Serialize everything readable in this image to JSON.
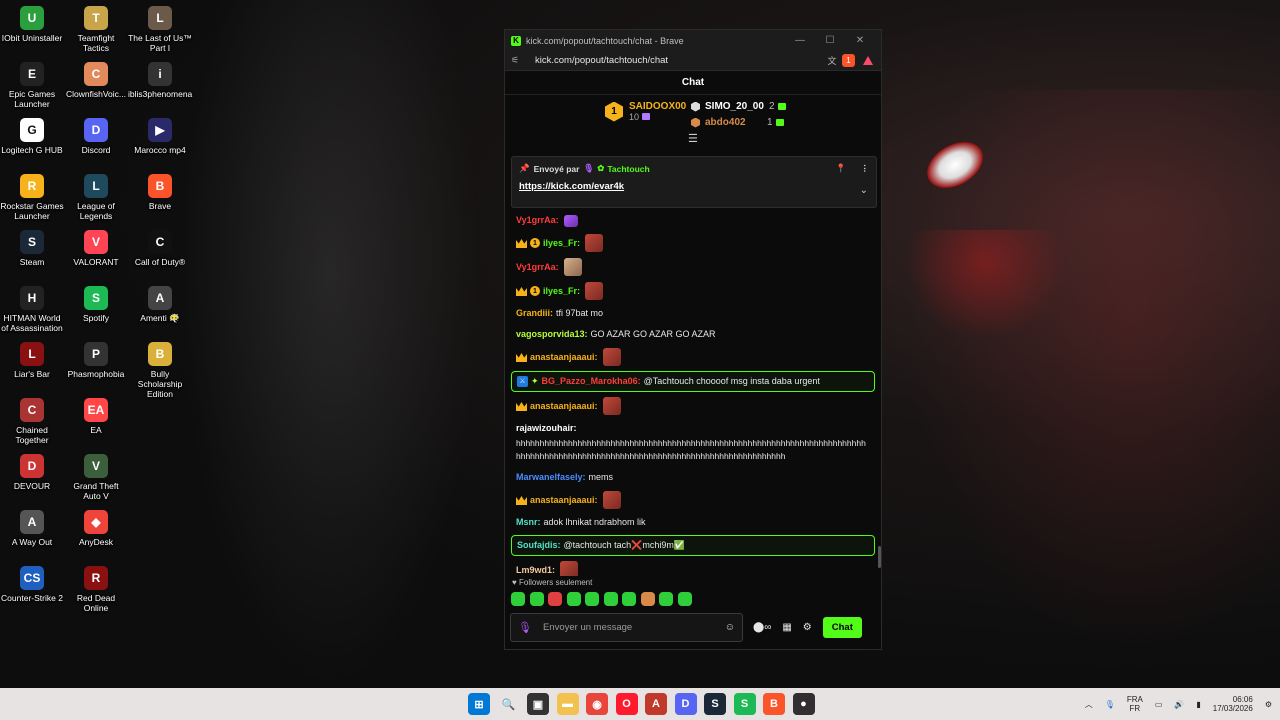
{
  "desktop": {
    "icons": [
      {
        "label": "IObit Uninstaller",
        "color": "#2b9e3d",
        "glyph": "U"
      },
      {
        "label": "Teamfight Tactics",
        "color": "#c8a54a",
        "glyph": "T"
      },
      {
        "label": "The Last of Us™ Part I",
        "color": "#6b5a4a",
        "glyph": "L"
      },
      {
        "label": "Epic Games Launcher",
        "color": "#222222",
        "glyph": "E"
      },
      {
        "label": "ClownfishVoic...",
        "color": "#e28a5c",
        "glyph": "C"
      },
      {
        "label": "iblis3phenomena",
        "color": "#333333",
        "glyph": "i"
      },
      {
        "label": "Logitech G HUB",
        "color": "#ffffff",
        "glyph": "G"
      },
      {
        "label": "Discord",
        "color": "#5865f2",
        "glyph": "D"
      },
      {
        "label": "Marocco mp4",
        "color": "#2a2a6a",
        "glyph": "▶"
      },
      {
        "label": "Rockstar Games Launcher",
        "color": "#f5b21b",
        "glyph": "R"
      },
      {
        "label": "League of Legends",
        "color": "#1f4a5e",
        "glyph": "L"
      },
      {
        "label": "Brave",
        "color": "#fb542b",
        "glyph": "B"
      },
      {
        "label": "Steam",
        "color": "#1b2838",
        "glyph": "S"
      },
      {
        "label": "VALORANT",
        "color": "#fd4556",
        "glyph": "V"
      },
      {
        "label": "Call of Duty®",
        "color": "#111111",
        "glyph": "C"
      },
      {
        "label": "HITMAN World of Assassination",
        "color": "#222222",
        "glyph": "H"
      },
      {
        "label": "Spotify",
        "color": "#1db954",
        "glyph": "S"
      },
      {
        "label": "Amenti 😶‍🌫️",
        "color": "#444444",
        "glyph": "A"
      },
      {
        "label": "Liar's Bar",
        "color": "#8a1111",
        "glyph": "L"
      },
      {
        "label": "Phasmophobia",
        "color": "#333333",
        "glyph": "P"
      },
      {
        "label": "Bully Scholarship Edition",
        "color": "#d9b13a",
        "glyph": "B"
      },
      {
        "label": "Chained Together",
        "color": "#a33",
        "glyph": "C"
      },
      {
        "label": "EA",
        "color": "#ff4747",
        "glyph": "EA"
      },
      {
        "label": "DEVOUR",
        "color": "#c33",
        "glyph": "D"
      },
      {
        "label": "Grand Theft Auto V",
        "color": "#3a5f3a",
        "glyph": "V"
      },
      {
        "label": "A Way Out",
        "color": "#555555",
        "glyph": "A"
      },
      {
        "label": "AnyDesk",
        "color": "#ef443b",
        "glyph": "◆"
      },
      {
        "label": "Counter-Strike 2",
        "color": "#1f5fbf",
        "glyph": "CS"
      },
      {
        "label": "Red Dead Online",
        "color": "#8a1111",
        "glyph": "R"
      }
    ]
  },
  "browser": {
    "title": "kick.com/popout/tachtouch/chat - Brave",
    "url": "kick.com/popout/tachtouch/chat",
    "brave_badge": "1",
    "min_label": "—",
    "max_label": "☐",
    "close_label": "✕"
  },
  "chat": {
    "header": "Chat",
    "leaderboard": {
      "first": {
        "rank": "1",
        "name": "SAIDOOX00",
        "count": "10"
      },
      "second": {
        "name": "SIMO_20_00",
        "count": "2"
      },
      "third": {
        "name": "abdo402",
        "count": "1"
      }
    },
    "pinned": {
      "prefix": "Envoyé par",
      "author": "Tachtouch",
      "link": "https://kick.com/evar4k"
    },
    "messages": [
      {
        "user": "Vy1grrAa",
        "color": "#ff3b3b",
        "text": "",
        "badges": [],
        "emote": "purple",
        "highlight": false
      },
      {
        "user": "ilyes_Fr",
        "color": "#53fc18",
        "text": "",
        "badges": [
          "crown",
          "coin"
        ],
        "emote": "red",
        "highlight": false
      },
      {
        "user": "Vy1grrAa",
        "color": "#ff3b3b",
        "text": "",
        "badges": [],
        "emote": "beige",
        "highlight": false
      },
      {
        "user": "ilyes_Fr",
        "color": "#53fc18",
        "text": "",
        "badges": [
          "crown",
          "coin"
        ],
        "emote": "red",
        "highlight": false
      },
      {
        "user": "Grandiii",
        "color": "#f5b21b",
        "text": "tfi 97bat mo",
        "badges": [],
        "emote": "",
        "highlight": false
      },
      {
        "user": "vagosporvida13",
        "color": "#b5ff3b",
        "text": "GO AZAR GO AZAR GO AZAR",
        "badges": [],
        "emote": "",
        "highlight": false
      },
      {
        "user": "anastaanjaaaui",
        "color": "#f5b21b",
        "text": "",
        "badges": [
          "crown"
        ],
        "emote": "red",
        "highlight": false
      },
      {
        "user": "BG_Pazzo_Marokha06",
        "color": "#ff3b3b",
        "text": "@Tachtouch choooof msg insta daba urgent",
        "badges": [
          "mod",
          "spark"
        ],
        "emote": "",
        "highlight": true
      },
      {
        "user": "anastaanjaaaui",
        "color": "#f5b21b",
        "text": "",
        "badges": [
          "crown"
        ],
        "emote": "red",
        "highlight": false
      },
      {
        "user": "rajawizouhair",
        "color": "#ffffff",
        "text": "hhhhhhhhhhhhhhhhhhhhhhhhhhhhhhhhhhhhhhhhhhhhhhhhhhhhhhhhhhhhhhhhhhhhhhhhhhhhhhhhhhhhhhhhhhhhhhhhhhhhhhhhhhhhhhhhhhhhhhhhhhhhhhhhhhh",
        "badges": [],
        "emote": "",
        "highlight": false,
        "multi": true
      },
      {
        "user": "Marwanelfasely",
        "color": "#4a8dff",
        "text": "mems",
        "badges": [],
        "emote": "",
        "highlight": false
      },
      {
        "user": "anastaanjaaaui",
        "color": "#f5b21b",
        "text": "",
        "badges": [
          "crown"
        ],
        "emote": "red",
        "highlight": false
      },
      {
        "user": "Msnr",
        "color": "#53e0c8",
        "text": "adok lhnikat ndrabhom lik",
        "badges": [],
        "emote": "",
        "highlight": false
      },
      {
        "user": "Soufajdis",
        "color": "#53e0c8",
        "text": "@tachtouch tach❌mchi9m✅",
        "badges": [],
        "emote": "",
        "highlight": true
      },
      {
        "user": "Lm9wd1",
        "color": "#f5c8a0",
        "text": "",
        "badges": [],
        "emote": "red",
        "highlight": false
      },
      {
        "user": "Lm9wd1",
        "color": "#f5c8a0",
        "text": "",
        "badges": [],
        "emote": "red",
        "highlight": false
      }
    ],
    "followers_only": "Followers seulement",
    "input_placeholder": "Envoyer un message",
    "send_label": "Chat"
  },
  "taskbar": {
    "apps": [
      {
        "name": "windows-start",
        "color": "#0078d4",
        "glyph": "⊞"
      },
      {
        "name": "search",
        "color": "transparent",
        "glyph": "🔍"
      },
      {
        "name": "task-view",
        "color": "#333333",
        "glyph": "▣"
      },
      {
        "name": "file-explorer",
        "color": "#f2c14e",
        "glyph": "▬"
      },
      {
        "name": "chrome",
        "color": "#e8453c",
        "glyph": "◉"
      },
      {
        "name": "opera",
        "color": "#ff1b2d",
        "glyph": "O"
      },
      {
        "name": "adobe",
        "color": "#c0392b",
        "glyph": "A"
      },
      {
        "name": "discord",
        "color": "#5865f2",
        "glyph": "D"
      },
      {
        "name": "steam",
        "color": "#1b2838",
        "glyph": "S"
      },
      {
        "name": "spotify",
        "color": "#1db954",
        "glyph": "S"
      },
      {
        "name": "brave",
        "color": "#fb542b",
        "glyph": "B"
      },
      {
        "name": "obs",
        "color": "#302e31",
        "glyph": "●"
      }
    ],
    "lang_top": "FRA",
    "lang_bottom": "FR",
    "time": "06:06",
    "date": "17/03/2026"
  }
}
